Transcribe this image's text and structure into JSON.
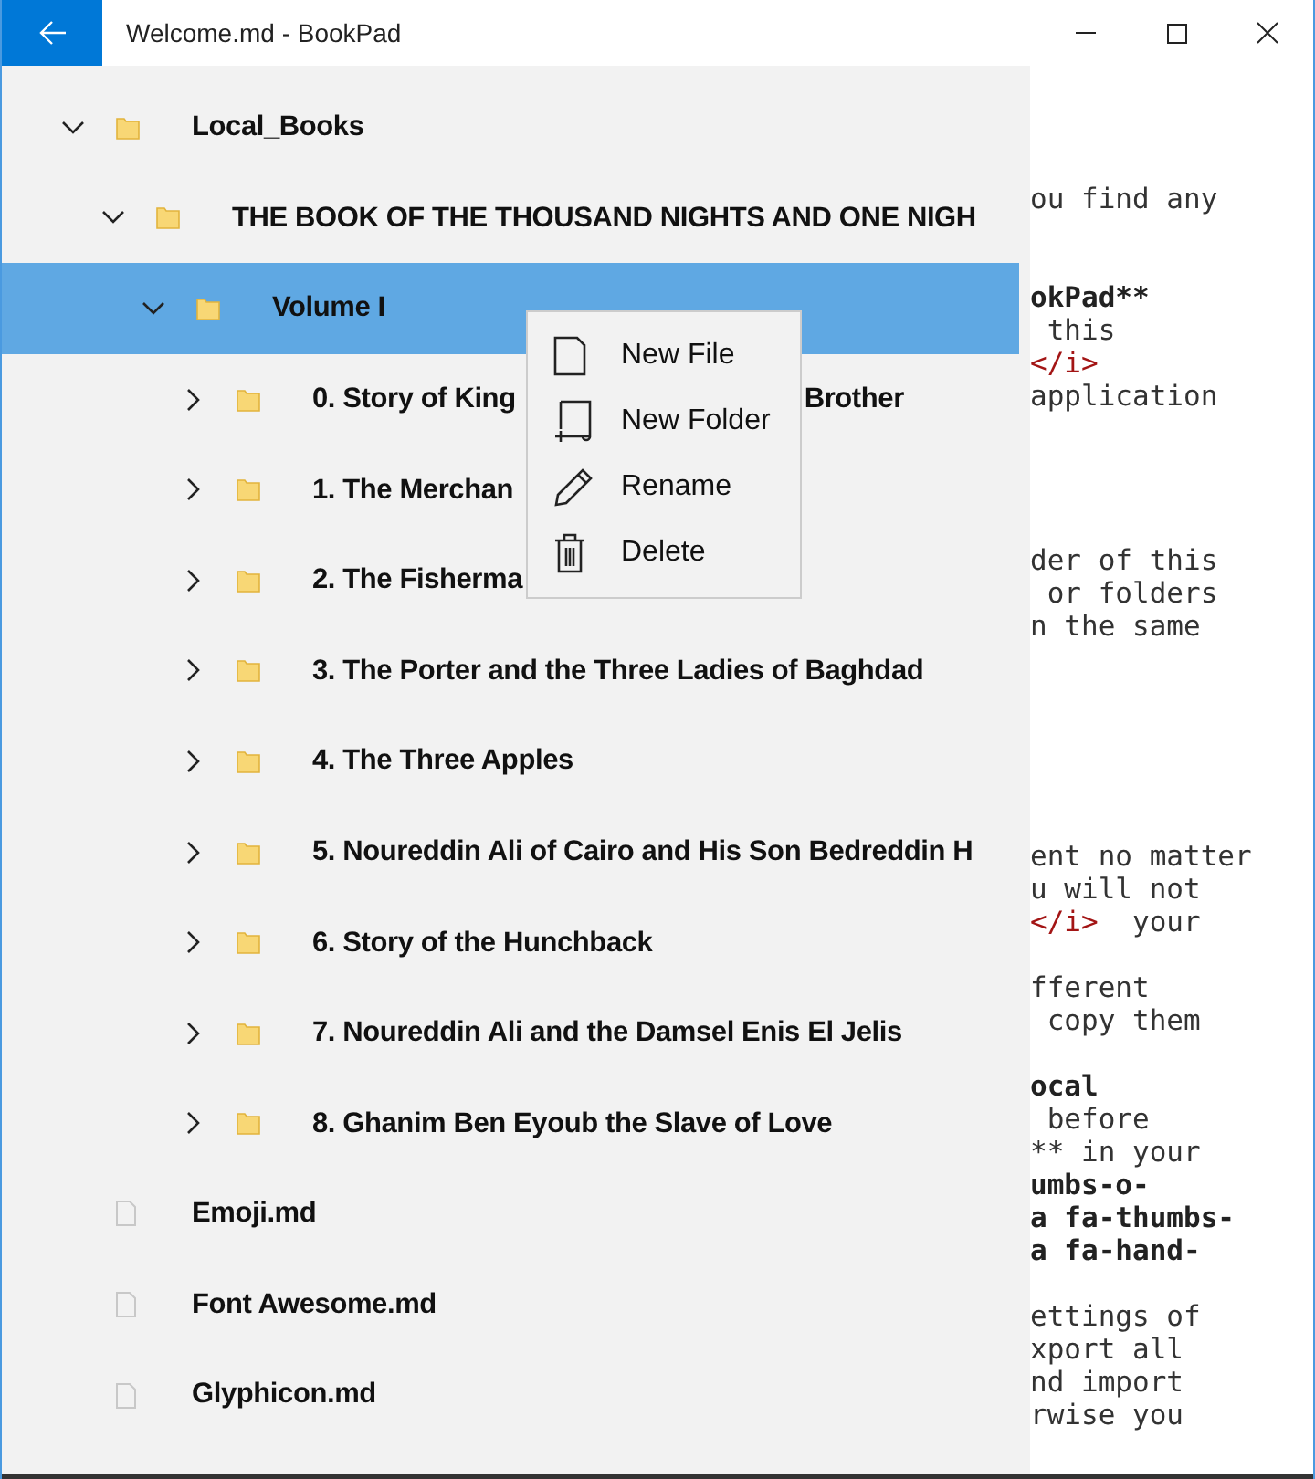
{
  "window": {
    "title": "Welcome.md - BookPad"
  },
  "editor": {
    "paragraphs": [
      {
        "lines": [
          [
            {
              "text": "ou find any",
              "kind": "plain"
            }
          ]
        ]
      },
      {
        "lines": [
          [
            {
              "text": "okPad**",
              "kind": "bold"
            }
          ],
          [
            {
              "text": " this",
              "kind": "plain"
            }
          ],
          [
            {
              "text": "</i>",
              "kind": "tag"
            }
          ],
          [
            {
              "text": "application",
              "kind": "plain"
            }
          ]
        ]
      },
      {
        "lines": [
          [
            {
              "text": "der of this",
              "kind": "plain"
            }
          ],
          [
            {
              "text": " or folders",
              "kind": "plain"
            }
          ],
          [
            {
              "text": "n the same",
              "kind": "plain"
            }
          ]
        ]
      },
      {
        "lines": [
          [
            {
              "text": "ent no matter",
              "kind": "plain"
            }
          ],
          [
            {
              "text": "u will not",
              "kind": "plain"
            }
          ],
          [
            {
              "text": "</i>",
              "kind": "tag"
            },
            {
              "text": "  your",
              "kind": "plain"
            }
          ]
        ]
      },
      {
        "lines": [
          [
            {
              "text": "fferent",
              "kind": "plain"
            }
          ],
          [
            {
              "text": " copy them",
              "kind": "plain"
            }
          ]
        ]
      },
      {
        "lines": [
          [
            {
              "text": "ocal",
              "kind": "bold"
            }
          ],
          [
            {
              "text": " before",
              "kind": "plain"
            }
          ],
          [
            {
              "text": "** in your",
              "kind": "plain"
            }
          ],
          [
            {
              "text": "umbs-o-",
              "kind": "bold"
            }
          ],
          [
            {
              "text": "a fa-thumbs-",
              "kind": "bold"
            }
          ],
          [
            {
              "text": "a fa-hand-",
              "kind": "bold"
            }
          ]
        ]
      },
      {
        "lines": [
          [
            {
              "text": "ettings of",
              "kind": "plain"
            }
          ],
          [
            {
              "text": "xport all",
              "kind": "plain"
            }
          ],
          [
            {
              "text": "nd import",
              "kind": "plain"
            }
          ],
          [
            {
              "text": "rwise you",
              "kind": "plain"
            }
          ]
        ]
      }
    ]
  },
  "tree": [
    {
      "label": "Local_Books",
      "kind": "folder",
      "expanded": true,
      "selected": false,
      "children": [
        {
          "label": "THE BOOK OF THE THOUSAND NIGHTS AND ONE NIGH",
          "kind": "folder",
          "expanded": true,
          "selected": false,
          "children": [
            {
              "label": "Volume I",
              "kind": "folder",
              "expanded": true,
              "selected": true,
              "children": [
                {
                  "label": "0. Story of King",
                  "kind": "folder",
                  "expanded": false,
                  "selected": false,
                  "tail": "Brother"
                },
                {
                  "label": "1. The Merchan",
                  "kind": "folder",
                  "expanded": false,
                  "selected": false
                },
                {
                  "label": "2. The Fisherma",
                  "kind": "folder",
                  "expanded": false,
                  "selected": false
                },
                {
                  "label": "3. The Porter and the Three Ladies of Baghdad",
                  "kind": "folder",
                  "expanded": false,
                  "selected": false
                },
                {
                  "label": "4.  The Three Apples",
                  "kind": "folder",
                  "expanded": false,
                  "selected": false
                },
                {
                  "label": "5. Noureddin Ali of Cairo and His Son Bedreddin H",
                  "kind": "folder",
                  "expanded": false,
                  "selected": false
                },
                {
                  "label": "6. Story of the Hunchback",
                  "kind": "folder",
                  "expanded": false,
                  "selected": false
                },
                {
                  "label": "7. Noureddin Ali and the Damsel Enis El Jelis",
                  "kind": "folder",
                  "expanded": false,
                  "selected": false
                },
                {
                  "label": "8. Ghanim Ben Eyoub the Slave of Love",
                  "kind": "folder",
                  "expanded": false,
                  "selected": false
                }
              ]
            }
          ]
        }
      ]
    },
    {
      "label": "Emoji.md",
      "kind": "file",
      "selected": false
    },
    {
      "label": "Font Awesome.md",
      "kind": "file",
      "selected": false
    },
    {
      "label": "Glyphicon.md",
      "kind": "file",
      "selected": false
    }
  ],
  "context_menu": [
    {
      "label": "New File",
      "kind": "file"
    },
    {
      "label": "New Folder",
      "kind": "folder"
    },
    {
      "label": "Rename",
      "kind": "rename"
    },
    {
      "label": "Delete",
      "kind": "delete"
    }
  ]
}
